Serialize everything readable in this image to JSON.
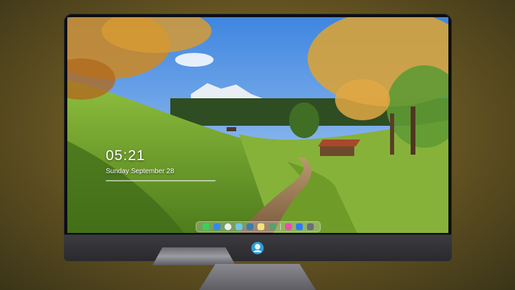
{
  "lock_screen": {
    "time": "05:21",
    "date": "Sunday September 28"
  },
  "dock": {
    "apps": [
      {
        "name": "messages",
        "color": "#3ad05a"
      },
      {
        "name": "finder",
        "color": "#2f8de8"
      },
      {
        "name": "safari",
        "color": "#e9eef3"
      },
      {
        "name": "photos",
        "color": "#6fc6e6"
      },
      {
        "name": "calendar",
        "color": "#3b7ea8"
      },
      {
        "name": "notes",
        "color": "#f6e27a"
      },
      {
        "name": "preview",
        "color": "#5a9f6d"
      },
      {
        "name": "music",
        "color": "#e84fb0"
      },
      {
        "name": "app-store",
        "color": "#2e7cf6"
      },
      {
        "name": "camera",
        "color": "#6e6e74"
      }
    ]
  },
  "colors": {
    "chin": "#2f2f33",
    "bezel": "#0d0d0f"
  }
}
